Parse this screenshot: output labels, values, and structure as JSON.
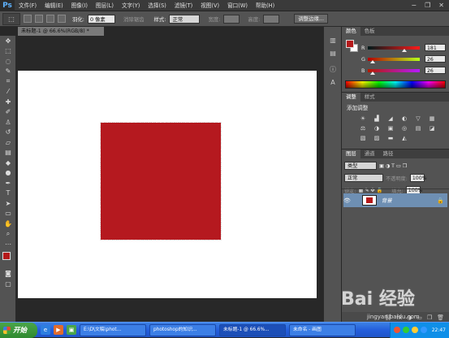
{
  "app": {
    "logo": "Ps"
  },
  "menu": [
    "文件(F)",
    "编辑(E)",
    "图像(I)",
    "图层(L)",
    "文字(Y)",
    "选择(S)",
    "滤镜(T)",
    "视图(V)",
    "窗口(W)",
    "帮助(H)"
  ],
  "window_controls": {
    "minimize": "−",
    "restore": "❐",
    "close": "✕"
  },
  "options_bar": {
    "feather_label": "羽化:",
    "feather_value": "0 像素",
    "antialias_label": "消除锯齿",
    "style_label": "样式:",
    "style_value": "正常",
    "width_label": "宽度:",
    "height_label": "高度:",
    "refine_edge_button": "调整边缘..."
  },
  "document": {
    "tab_title": "未标题-1 @ 66.6%(RGB/8) *",
    "square_color": "#b5191f"
  },
  "color_panel": {
    "tabs": [
      "颜色",
      "色板"
    ],
    "fg_color": "#b5191a",
    "channels": [
      {
        "label": "R",
        "value": "181",
        "level": 0.71
      },
      {
        "label": "G",
        "value": "26",
        "level": 0.1
      },
      {
        "label": "B",
        "value": "26",
        "level": 0.1
      }
    ]
  },
  "adjustments_panel": {
    "tabs": [
      "调整",
      "样式"
    ],
    "title": "添加调整",
    "icons": [
      "brightness-icon",
      "levels-icon",
      "curves-icon",
      "exposure-icon",
      "vibrance-icon",
      "hue-sat-icon",
      "color-balance-icon",
      "bw-icon",
      "photo-filter-icon",
      "channel-mixer-icon",
      "color-lookup-icon",
      "invert-icon",
      "posterize-icon",
      "threshold-icon",
      "gradient-map-icon",
      "selective-color-icon"
    ],
    "glyphs": [
      "☀",
      "▟",
      "◢",
      "◐",
      "▽",
      "▦",
      "⚖",
      "◑",
      "▣",
      "◎",
      "▤",
      "◪",
      "▧",
      "▨",
      "▬",
      "◭"
    ]
  },
  "layers_panel": {
    "tabs": [
      "图层",
      "通道",
      "路径"
    ],
    "kind_label": "类型",
    "blend_mode": "正常",
    "opacity_label": "不透明度:",
    "opacity_value": "100%",
    "lock_label": "锁定:",
    "fill_label": "填充:",
    "fill_value": "100%",
    "layers": [
      {
        "name": "背景",
        "locked": true,
        "visible": true
      }
    ],
    "bottom_icons": [
      "⛓",
      "fx",
      "◑",
      "▭",
      "❒",
      "🗑"
    ]
  },
  "taskbar": {
    "start": "开始",
    "tasks": [
      {
        "label": "E:\\D\\文稿\\phot...",
        "active": false
      },
      {
        "label": "photoshop的知识...",
        "active": false
      },
      {
        "label": "未标题-1 @ 66.6%...",
        "active": true
      },
      {
        "label": "未命名 - 画图",
        "active": false
      }
    ],
    "clock": "22:47"
  },
  "watermark": {
    "text": "Bai 经验",
    "sub": "jingyan.baidu.com"
  }
}
